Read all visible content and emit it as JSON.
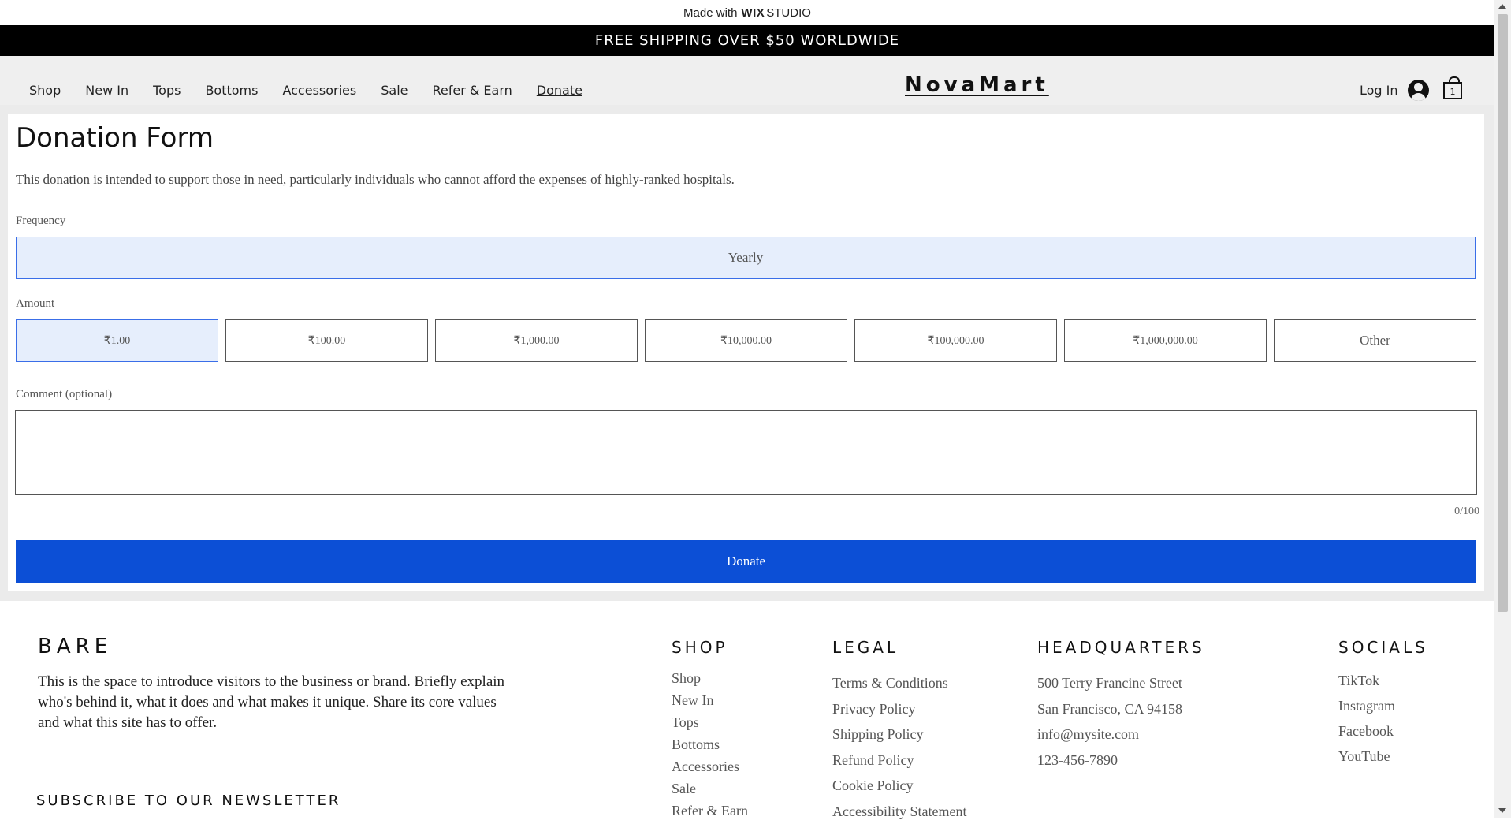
{
  "wix_banner": {
    "made_with": "Made with",
    "brand": "WIX",
    "studio": "STUDIO"
  },
  "promo": {
    "text": "FREE SHIPPING OVER $50 WORLDWIDE"
  },
  "header": {
    "nav": [
      "Shop",
      "New In",
      "Tops",
      "Bottoms",
      "Accessories",
      "Sale",
      "Refer & Earn",
      "Donate"
    ],
    "active_nav": "Donate",
    "logo": "NovaMart",
    "login_label": "Log In",
    "cart_count": "1"
  },
  "form": {
    "title": "Donation Form",
    "description": "This donation is intended to support those in need, particularly individuals who cannot afford the expenses of highly-ranked hospitals.",
    "frequency_label": "Frequency",
    "frequency_value": "Yearly",
    "amount_label": "Amount",
    "amounts": [
      "₹1.00",
      "₹100.00",
      "₹1,000.00",
      "₹10,000.00",
      "₹100,000.00",
      "₹1,000,000.00",
      "Other"
    ],
    "selected_amount": "₹1.00",
    "comment_label": "Comment (optional)",
    "comment_value": "",
    "char_counter": "0/100",
    "submit_label": "Donate"
  },
  "footer": {
    "brand": "BARE",
    "brand_text": "This is the space to introduce visitors to the business or brand. Briefly explain who's behind it, what it does and what makes it unique. Share its core values and what this site has to offer.",
    "newsletter_title": "SUBSCRIBE TO OUR NEWSLETTER",
    "shop": {
      "title": "SHOP",
      "items": [
        "Shop",
        "New In",
        "Tops",
        "Bottoms",
        "Accessories",
        "Sale",
        "Refer & Earn"
      ]
    },
    "legal": {
      "title": "LEGAL",
      "items": [
        "Terms & Conditions",
        "Privacy Policy",
        "Shipping Policy",
        "Refund Policy",
        "Cookie Policy",
        "Accessibility Statement"
      ]
    },
    "headquarters": {
      "title": "HEADQUARTERS",
      "items": [
        "500 Terry Francine Street",
        "San Francisco, CA 94158",
        "info@mysite.com",
        "123-456-7890"
      ]
    },
    "socials": {
      "title": "SOCIALS",
      "items": [
        "TikTok",
        "Instagram",
        "Facebook",
        "YouTube"
      ]
    }
  },
  "colors": {
    "accent": "#0c4fd6",
    "selected_bg": "#e6eefc",
    "selected_border": "#3a6ee8"
  }
}
